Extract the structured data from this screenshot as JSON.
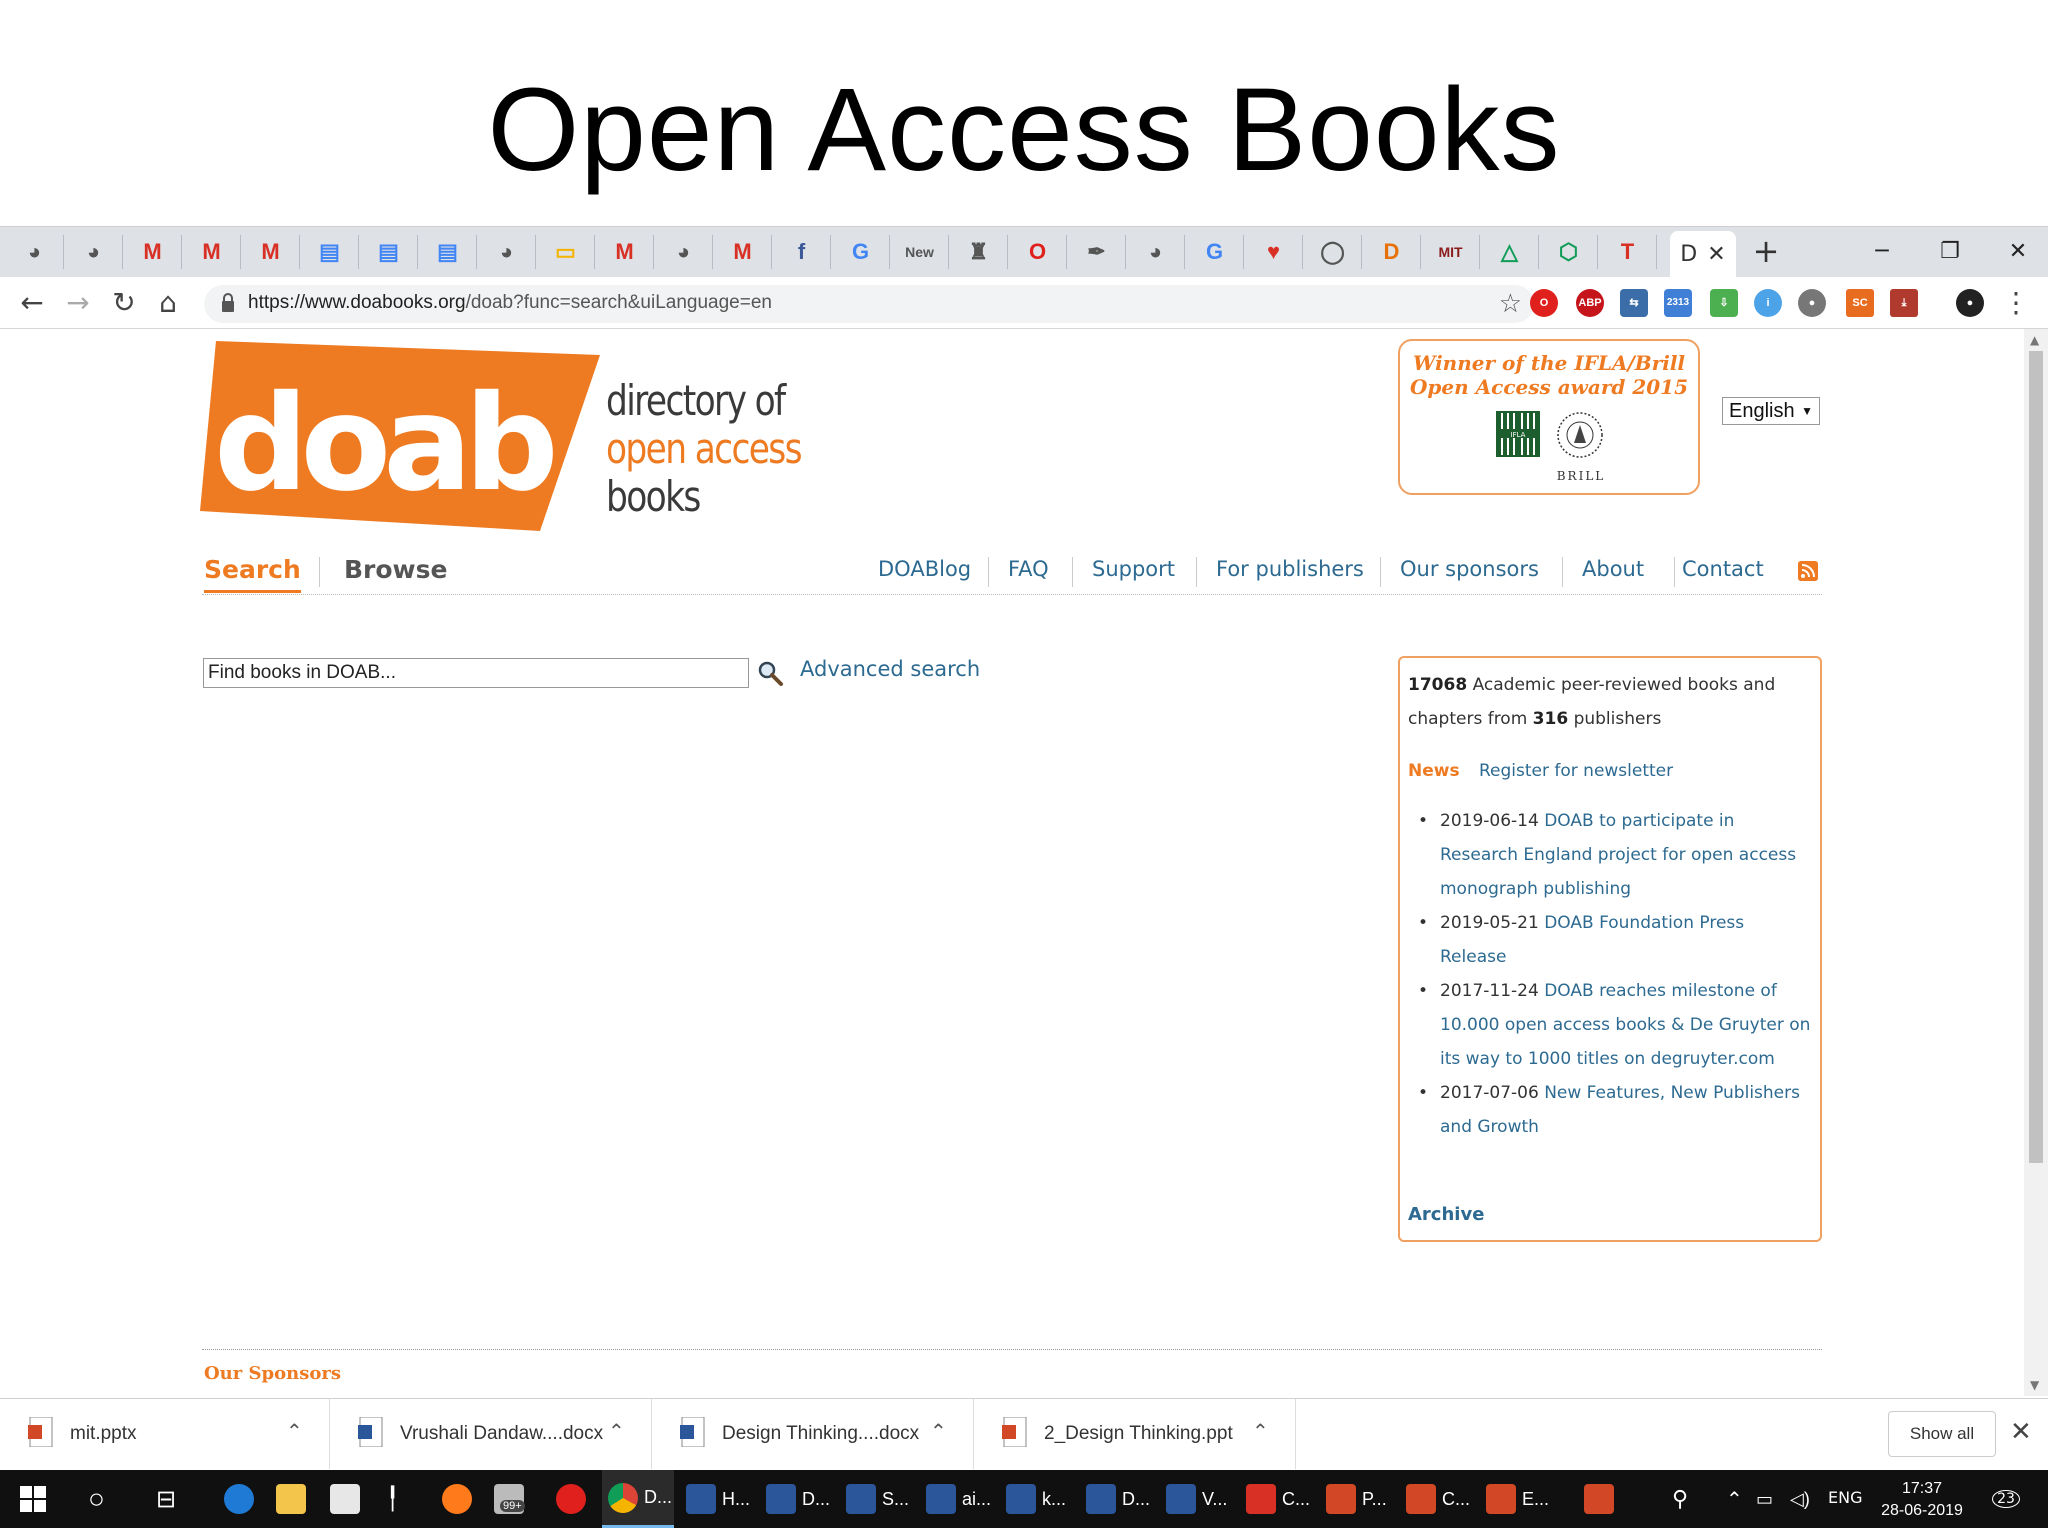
{
  "slide": {
    "title": "Open Access Books"
  },
  "browser": {
    "tabs": [
      {
        "icon": "globe-icon",
        "glyph": "◕"
      },
      {
        "icon": "globe-icon",
        "glyph": "◕"
      },
      {
        "icon": "gmail-icon",
        "glyph": "M"
      },
      {
        "icon": "gmail-icon",
        "glyph": "M"
      },
      {
        "icon": "gmail-icon",
        "glyph": "M"
      },
      {
        "icon": "docs-icon",
        "glyph": "▤"
      },
      {
        "icon": "docs-icon",
        "glyph": "▤"
      },
      {
        "icon": "docs-icon",
        "glyph": "▤"
      },
      {
        "icon": "globe-icon",
        "glyph": "◕"
      },
      {
        "icon": "slides-icon",
        "glyph": "▭"
      },
      {
        "icon": "gmail-icon",
        "glyph": "M"
      },
      {
        "icon": "globe-icon",
        "glyph": "◕"
      },
      {
        "icon": "gmail-icon",
        "glyph": "M"
      },
      {
        "icon": "facebook-icon",
        "glyph": "f"
      },
      {
        "icon": "google-icon",
        "glyph": "G"
      },
      {
        "icon": "new-tab-icon",
        "glyph": "New"
      },
      {
        "icon": "site-icon",
        "glyph": "♜"
      },
      {
        "icon": "opera-icon",
        "glyph": "O"
      },
      {
        "icon": "pen-icon",
        "glyph": "✒"
      },
      {
        "icon": "globe-icon",
        "glyph": "◕"
      },
      {
        "icon": "google-icon",
        "glyph": "G"
      },
      {
        "icon": "heart-icon",
        "glyph": "♥"
      },
      {
        "icon": "circle-icon",
        "glyph": "◯"
      },
      {
        "icon": "d-icon",
        "glyph": "D"
      },
      {
        "icon": "mit-icon",
        "glyph": "MIT"
      },
      {
        "icon": "drive-icon",
        "glyph": "△"
      },
      {
        "icon": "shield-icon",
        "glyph": "⬡"
      },
      {
        "icon": "t-icon",
        "glyph": "T"
      }
    ],
    "active_tab_label": "D",
    "url_host": "https://www.doabooks.org",
    "url_path": "/doab?func=search&uiLanguage=en",
    "extension_badge": "2313"
  },
  "page": {
    "logo_text": "doab",
    "tagline": [
      "directory of",
      "open access",
      "books"
    ],
    "award": {
      "line1": "Winner of the IFLA/Brill",
      "line2": "Open Access award 2015",
      "ifla": "IFLA",
      "brill": "BRILL"
    },
    "language": "English",
    "nav": {
      "search": "Search",
      "browse": "Browse",
      "links": [
        "DOABlog",
        "FAQ",
        "Support",
        "For publishers",
        "Our sponsors",
        "About",
        "Contact"
      ]
    },
    "search": {
      "value": "Find books in DOAB...",
      "advanced": "Advanced search"
    },
    "stats": {
      "books": "17068",
      "text_mid": "Academic peer-reviewed books and chapters from",
      "publishers": "316",
      "text_end": "publishers"
    },
    "news": {
      "label": "News",
      "newsletter": "Register for newsletter",
      "items": [
        {
          "date": "2019-06-14",
          "title": "DOAB to participate in Research England project for open access monograph publishing"
        },
        {
          "date": "2019-05-21",
          "title": "DOAB Foundation Press Release"
        },
        {
          "date": "2017-11-24",
          "title": "DOAB reaches milestone of 10.000 open access books & De Gruyter on its way to 1000 titles on degruyter.com"
        },
        {
          "date": "2017-07-06",
          "title": "New Features, New Publishers and Growth"
        }
      ],
      "archive": "Archive"
    },
    "sponsors_title": "Our Sponsors"
  },
  "downloads": {
    "items": [
      {
        "name": "mit.pptx",
        "type": "ppt"
      },
      {
        "name": "Vrushali Dandaw....docx",
        "type": "doc"
      },
      {
        "name": "Design Thinking....docx",
        "type": "doc"
      },
      {
        "name": "2_Design Thinking.ppt",
        "type": "ppt"
      }
    ],
    "show_all": "Show all"
  },
  "taskbar": {
    "apps": [
      {
        "icon": "chrome-icon",
        "label": "D..."
      },
      {
        "icon": "word-icon",
        "label": "H..."
      },
      {
        "icon": "word-icon",
        "label": "D..."
      },
      {
        "icon": "word-icon",
        "label": "S..."
      },
      {
        "icon": "word-icon",
        "label": "ai..."
      },
      {
        "icon": "word-icon",
        "label": "k..."
      },
      {
        "icon": "word-icon",
        "label": "D..."
      },
      {
        "icon": "word-icon",
        "label": "V..."
      },
      {
        "icon": "pdf-icon",
        "label": "C..."
      },
      {
        "icon": "powerpoint-icon",
        "label": "P..."
      },
      {
        "icon": "powerpoint-icon",
        "label": "C..."
      },
      {
        "icon": "powerpoint-icon",
        "label": "E..."
      },
      {
        "icon": "powerpoint-icon",
        "label": ""
      }
    ],
    "mail_badge": "99+",
    "language": "ENG",
    "time": "17:37",
    "date": "28-06-2019",
    "notifications": "23"
  },
  "colors": {
    "accent": "#ee7a21",
    "link": "#2d6a91",
    "taskbar": "#101010"
  }
}
